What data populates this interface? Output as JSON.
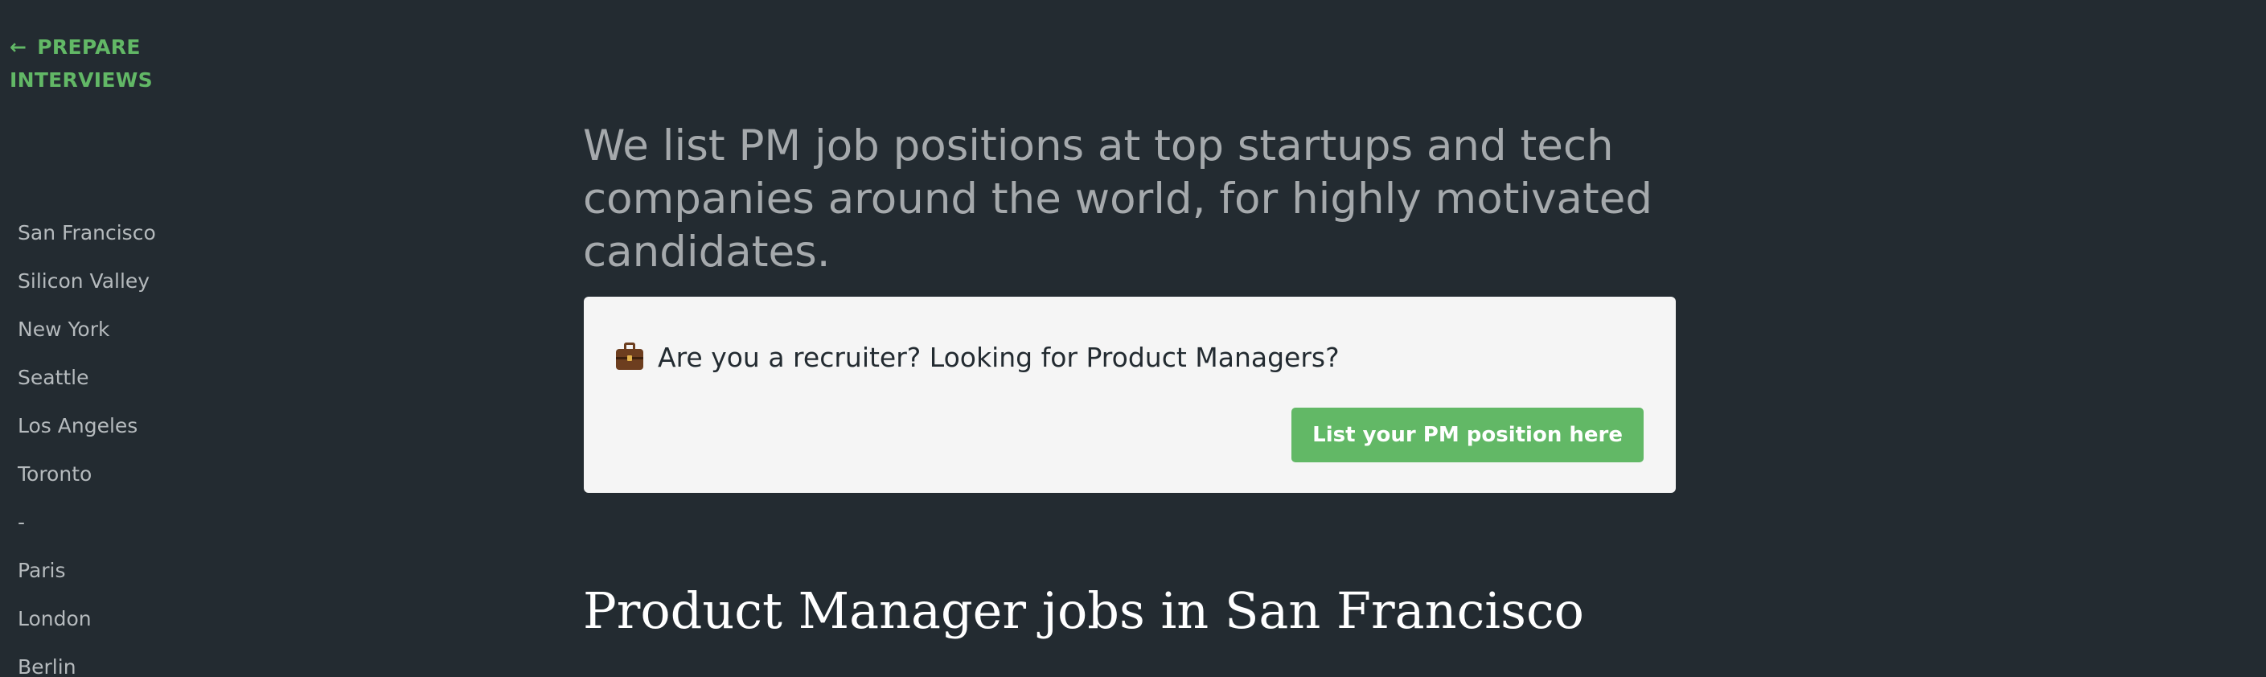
{
  "back_link": {
    "arrow": "←",
    "label": "PREPARE INTERVIEWS"
  },
  "sidebar": {
    "items": [
      {
        "label": "San Francisco"
      },
      {
        "label": "Silicon Valley"
      },
      {
        "label": "New York"
      },
      {
        "label": "Seattle"
      },
      {
        "label": "Los Angeles"
      },
      {
        "label": "Toronto"
      },
      {
        "label": "-"
      },
      {
        "label": "Paris"
      },
      {
        "label": "London"
      },
      {
        "label": "Berlin"
      }
    ]
  },
  "main": {
    "tagline": "We list PM job positions at top startups and tech companies around the world, for highly motivated candidates.",
    "recruiter_card": {
      "icon": "briefcase-icon",
      "question": "Are you a recruiter? Looking for Product Managers?",
      "button_label": "List your PM position here"
    },
    "section_title": "Product Manager jobs in San Francisco"
  },
  "colors": {
    "background": "#232b31",
    "accent": "#62b866",
    "card_background": "#f5f5f5",
    "muted_text": "#a5a9ac"
  }
}
